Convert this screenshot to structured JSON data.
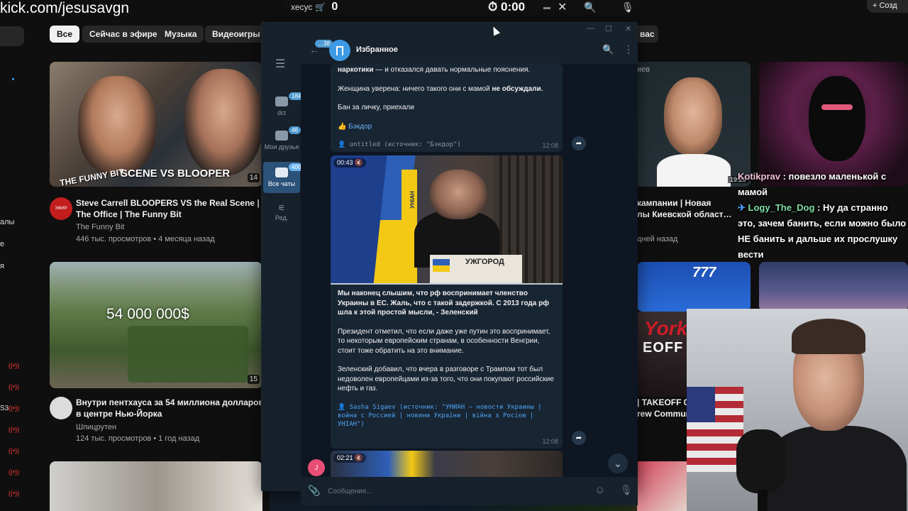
{
  "stream": {
    "url": "kick.com/jesusavgn",
    "overlay_name": "хесус",
    "overlay_count": "0",
    "overlay_timer": "0:00",
    "create_label": "+ Созд"
  },
  "chat": [
    {
      "user": "Kotikprav",
      "text": " : повезло маленькой с мамой"
    },
    {
      "user": "Logy_The_Dog",
      "text": " : Ну да странно это, зачем банить, если можно было НЕ банить и дальше их прослушку вести"
    }
  ],
  "youtube": {
    "chips": [
      "Все",
      "Сейчас в эфире",
      "Музыка",
      "Видеоигры"
    ],
    "chip_right": "вас",
    "sidebar_text": [
      "алы",
      "e",
      "я",
      "S3"
    ],
    "videos": [
      {
        "title": "Steve Carrell BLOOPERS VS the Real Scene | The Office | The Funny Bit",
        "channel": "The Funny Bit",
        "meta": "446 тыс. просмотров • 4 месяца назад",
        "thumb_text": "SCENE VS BLOOPER",
        "thumb_badge": "THE FUNNY BIT",
        "avatar_label": "ЭФИР",
        "duration": "14"
      },
      {
        "title": "Внутри пентхауса за 54 миллиона долларов в центре Нью-Йорка",
        "channel": "Шпицрутен",
        "meta": "124 тыс. просмотров • 1 год назад",
        "thumb_text": "54 000 000$",
        "duration": "15"
      }
    ],
    "right_label": "иев",
    "right_videos": [
      {
        "title": "кампании | Новая",
        "title2": "лы Киевской област…",
        "meta": "дней назад"
      },
      {
        "title": "| TAKEOFF 0",
        "title2": "rew Commun"
      }
    ],
    "r2_time": "19:25",
    "thumb_york": "York",
    "thumb_off": "EOFF",
    "thumb_boeing": "777"
  },
  "telegram": {
    "window_controls": [
      "—",
      "☐",
      "✕"
    ],
    "folders": [
      {
        "label": "dct",
        "badge": "184",
        "active": false
      },
      {
        "label": "Мои друзья",
        "badge": "46",
        "active": false
      },
      {
        "label": "Все чаты",
        "badge": "400",
        "active": true
      },
      {
        "label": "Ред.",
        "badge": "",
        "active": false
      }
    ],
    "back_badge": "38",
    "chat_title": "Избранное",
    "msg1": {
      "line1_bold": "наркотики",
      "line1_rest": " — и отказался давать нормальные пояснения.",
      "line2_start": "Женщина уверена: ничего такого они с мамой ",
      "line2_bold": "не обсуждали.",
      "line3": "Бан за личку, приехали",
      "line4": "👍 Бэкдор",
      "sig": "👤 untitled (источник: \"Бэкдор\")",
      "time": "12:08"
    },
    "video1": {
      "duration": "00:43",
      "podium": "УЖГОРОД",
      "brand": "УНІАН"
    },
    "msg2": {
      "p1": "Мы наконец слышим, что рф воспринимает членство Украины в ЕС. Жаль, что с такой задержкой. С 2013 года рф шла к этой простой мысли, - Зеленский",
      "p2": "Президент отметил, что если даже уже путин это воспринимает, то некоторым европейским странам, в особенности Венгрии, стоит тоже обратить на это внимание.",
      "p3": "Зеленский добавил, что вчера в разговоре с Трампом тот был недоволен европейцами из-за того, что они покупают российские нефть и газ.",
      "sig": "👤 Sasha Sigaev (источник: \"УНИАН — новости Украины | война с Россией | новини України | війна з Росією | УНІАН\")",
      "time": "12:08"
    },
    "video2": {
      "duration": "02:21"
    },
    "user_avatar": "J",
    "input_placeholder": "Сообщение..."
  }
}
